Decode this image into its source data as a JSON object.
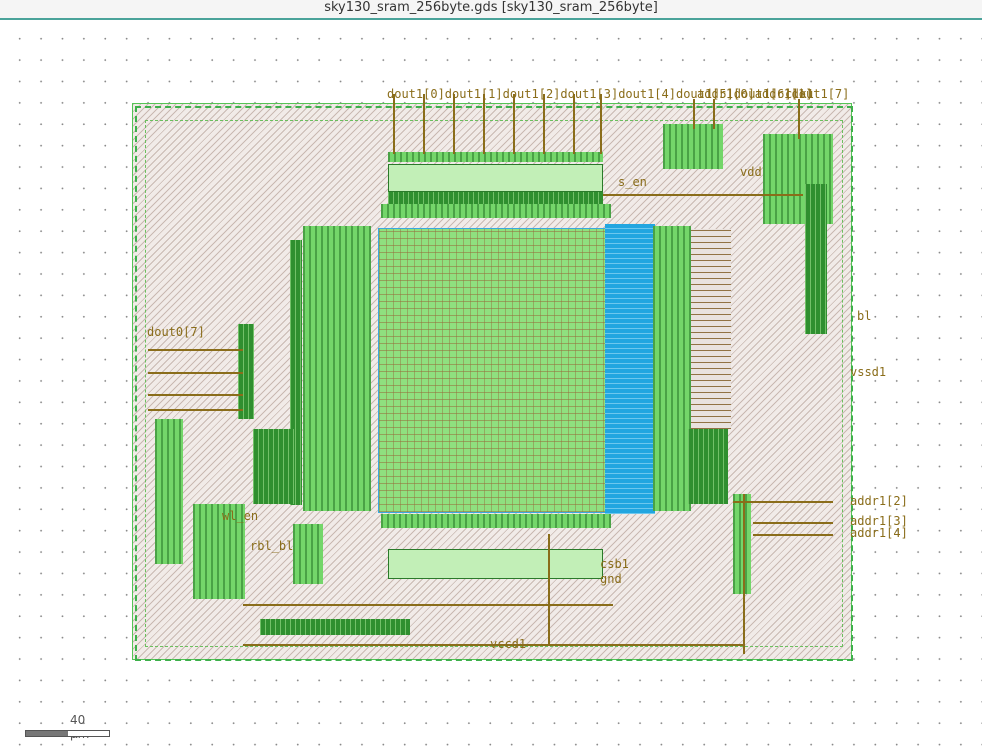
{
  "window": {
    "title": "sky130_sram_256byte.gds [sky130_sram_256byte]"
  },
  "scale": {
    "label": "40 µm"
  },
  "labels": {
    "dout_group": "dout1[0]dout1[1]dout1[2]dout1[3]dout1[4]dout1[5]dout1[6]dout1[7]",
    "addr_top": "addr1[0]addr1[1]",
    "clk": "clk1",
    "bl": "bl",
    "vssd": "vssd1",
    "addr2": "addr1[2]",
    "addr3": "addr1[3]",
    "addr4": "addr1[4]",
    "vccd": "vccd1",
    "gnd": "gnd",
    "vdd": "vdd",
    "rbl": "rbl_bl",
    "wl": "wl_en",
    "s_en": "s_en",
    "csb": "csb1",
    "dout_left": "dout0[7]"
  },
  "colors": {
    "metal1": "#8fe07f",
    "metal2": "#2f8f2f",
    "via": "#22a6e0",
    "label": "#8a6d1a",
    "boundary": "#55c455",
    "accent": "#4aa39a"
  }
}
